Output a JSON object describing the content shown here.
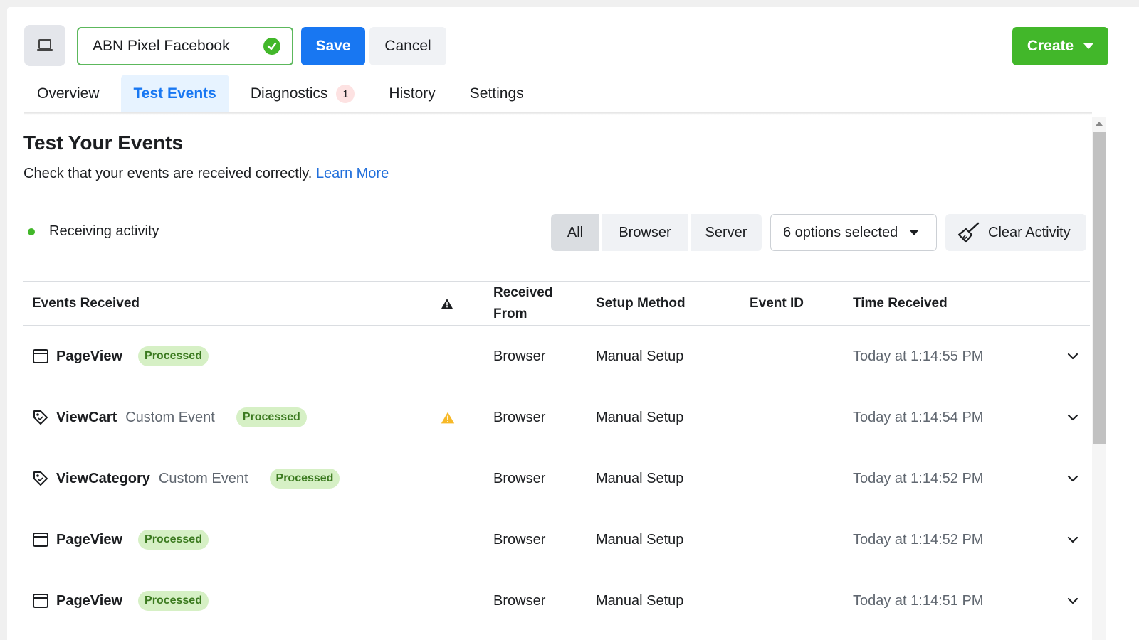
{
  "header": {
    "pixel_name": "ABN Pixel Facebook",
    "save_label": "Save",
    "cancel_label": "Cancel",
    "create_label": "Create"
  },
  "tabs": [
    {
      "label": "Overview"
    },
    {
      "label": "Test Events"
    },
    {
      "label": "Diagnostics",
      "badge": "1"
    },
    {
      "label": "History"
    },
    {
      "label": "Settings"
    }
  ],
  "main": {
    "title": "Test Your Events",
    "subtitle": "Check that your events are received correctly.",
    "learn_more": "Learn More",
    "status": "Receiving activity",
    "filters": {
      "all": "All",
      "browser": "Browser",
      "server": "Server"
    },
    "options_select": "6 options selected",
    "clear_activity": "Clear Activity"
  },
  "table": {
    "headers": {
      "events_received": "Events Received",
      "received_from_line1": "Received",
      "received_from_line2": "From",
      "setup_method": "Setup Method",
      "event_id": "Event ID",
      "time_received": "Time Received"
    },
    "rows": [
      {
        "icon": "browser-window-icon",
        "name": "PageView",
        "sub": "",
        "status": "Processed",
        "warning": false,
        "from": "Browser",
        "setup": "Manual Setup",
        "time": "Today at 1:14:55 PM"
      },
      {
        "icon": "tag-icon",
        "name": "ViewCart",
        "sub": "Custom Event",
        "status": "Processed",
        "warning": true,
        "from": "Browser",
        "setup": "Manual Setup",
        "time": "Today at 1:14:54 PM"
      },
      {
        "icon": "tag-icon",
        "name": "ViewCategory",
        "sub": "Custom Event",
        "status": "Processed",
        "warning": false,
        "from": "Browser",
        "setup": "Manual Setup",
        "time": "Today at 1:14:52 PM"
      },
      {
        "icon": "browser-window-icon",
        "name": "PageView",
        "sub": "",
        "status": "Processed",
        "warning": false,
        "from": "Browser",
        "setup": "Manual Setup",
        "time": "Today at 1:14:52 PM"
      },
      {
        "icon": "browser-window-icon",
        "name": "PageView",
        "sub": "",
        "status": "Processed",
        "warning": false,
        "from": "Browser",
        "setup": "Manual Setup",
        "time": "Today at 1:14:51 PM"
      }
    ]
  },
  "colors": {
    "primary_blue": "#1877f2",
    "success_green": "#42b72a",
    "warning_yellow": "#f7b928",
    "processed_pill": "#d6f0c5"
  }
}
